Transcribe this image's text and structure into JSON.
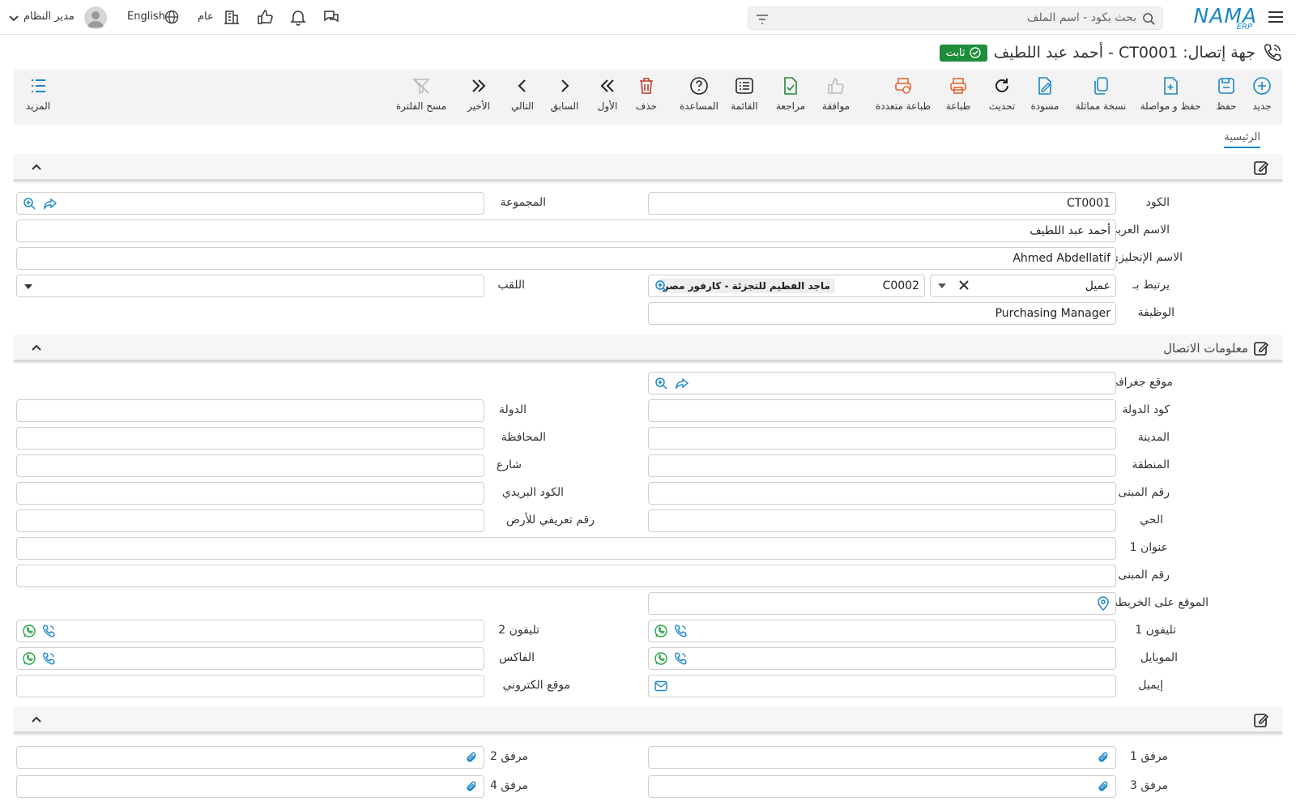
{
  "topbar": {
    "logo_text": "NAMA",
    "logo_sub": "ERP",
    "search_placeholder": "بحث بكود - اسم الملف",
    "branch_label": "عام",
    "language_label": "English",
    "user_label": "مدير النظام"
  },
  "page": {
    "title": "جهة إتصال: CT0001 - أحمد عبد اللطيف",
    "status_badge": "ثابت"
  },
  "toolbar": {
    "buttons": [
      {
        "label": "جديد",
        "icon": "plus-circle-icon"
      },
      {
        "label": "حفظ",
        "icon": "save-icon"
      },
      {
        "label": "حفظ و مواصلة",
        "icon": "save-continue-icon"
      },
      {
        "label": "نسخة مماثلة",
        "icon": "copy-icon"
      },
      {
        "label": "مسودة",
        "icon": "draft-icon"
      },
      {
        "label": "تحديث",
        "icon": "refresh-icon"
      },
      {
        "label": "طباعة",
        "icon": "print-icon"
      },
      {
        "label": "طباعة متعددة",
        "icon": "multi-print-icon"
      },
      {
        "label": "موافقة",
        "icon": "thumbs-up-icon"
      },
      {
        "label": "مراجعة",
        "icon": "review-icon"
      },
      {
        "label": "القائمة",
        "icon": "list-icon"
      },
      {
        "label": "المساعدة",
        "icon": "help-icon"
      },
      {
        "label": "حذف",
        "icon": "trash-icon"
      },
      {
        "label": "الأول",
        "icon": "first-icon"
      },
      {
        "label": "السابق",
        "icon": "previous-icon"
      },
      {
        "label": "التالي",
        "icon": "next-icon"
      },
      {
        "label": "الأخير",
        "icon": "last-icon"
      },
      {
        "label": "مسح الفلترة",
        "icon": "clear-filter-icon"
      }
    ],
    "more_label": "المزيد"
  },
  "tabs": {
    "home": "الرئيسية"
  },
  "main": {
    "code_label": "الكود",
    "code_value": "CT0001",
    "group_label": "المجموعة",
    "arabic_name_label": "الاسم العربي",
    "arabic_name_value": "أحمد عبد اللطيف",
    "english_name_label": "الاسم الإنجليزي",
    "english_name_value": "Ahmed Abdellatif",
    "related_label": "يرتبط بـ",
    "related_type_value": "عميل",
    "related_code_value": "C0002",
    "related_name_value": "ماجد الفطيم للتجزئة - كارفور مصر",
    "title_label": "اللقب",
    "job_label": "الوظيفة",
    "job_value": "Purchasing Manager"
  },
  "contact": {
    "section_title": "معلومات الاتصال",
    "geo_location_label": "موقع جغرافي",
    "country_code_label": "كود الدولة",
    "country_label": "الدولة",
    "city_label": "المدينة",
    "governorate_label": "المحافظة",
    "region_label": "المنطقة",
    "street_label": "شارع",
    "building_number_label": "رقم المبنى",
    "postal_code_label": "الكود البريدي",
    "district_label": "الحي",
    "land_id_label": "رقم تعريفي للأرض",
    "address1_label": "عنوان 1",
    "building_number2_label": "رقم المبنى",
    "map_location_label": "الموقع على الخريطة",
    "phone1_label": "تليفون 1",
    "phone2_label": "تليفون 2",
    "mobile_label": "الموبايل",
    "fax_label": "الفاكس",
    "email_label": "إيميل",
    "website_label": "موقع الكتروني"
  },
  "attachments": {
    "attachment1_label": "مرفق 1",
    "attachment2_label": "مرفق 2",
    "attachment3_label": "مرفق 3",
    "attachment4_label": "مرفق 4"
  },
  "colors": {
    "accent": "#1a86c7",
    "badge": "#1e8c3a",
    "whatsapp": "#25a244",
    "print": "#e8612c",
    "delete": "#c0392b"
  }
}
